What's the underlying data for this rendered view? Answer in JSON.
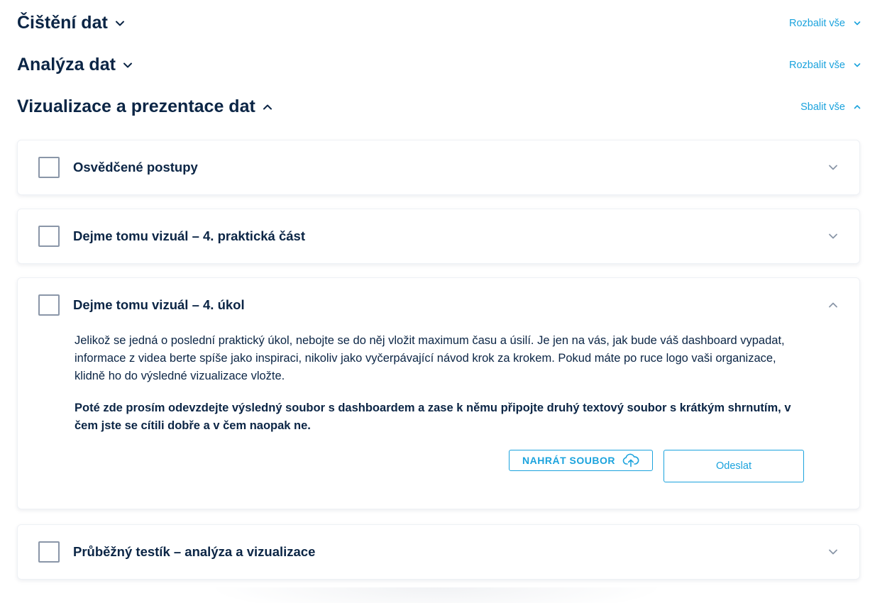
{
  "sections": [
    {
      "title": "Čištění dat",
      "toggle_label": "Rozbalit vše",
      "expanded": false
    },
    {
      "title": "Analýza dat",
      "toggle_label": "Rozbalit vše",
      "expanded": false
    },
    {
      "title": "Vizualizace a prezentace dat",
      "toggle_label": "Sbalit vše",
      "expanded": true
    }
  ],
  "items": [
    {
      "title": "Osvědčené postupy",
      "checked": false,
      "expanded": false
    },
    {
      "title": "Dejme tomu vizuál – 4. praktická část",
      "checked": false,
      "expanded": false
    },
    {
      "title": "Dejme tomu vizuál – 4. úkol",
      "checked": false,
      "expanded": true,
      "body": "Jelikož se jedná o poslední praktický úkol, nebojte se do něj vložit maximum času a úsilí. Je jen na vás, jak bude váš dashboard vypadat, informace z videa berte spíše jako inspiraci, nikoliv jako vyčerpávající návod krok za krokem. Pokud máte po ruce logo vaši organizace, klidně ho do výsledné vizualizace vložte.",
      "instruction": "Poté zde prosím odevzdejte výsledný soubor s dashboardem a zase k němu připojte druhý textový soubor s krátkým shrnutím, v čem jste se cítili dobře a v čem naopak ne.",
      "upload_label": "NAHRÁT SOUBOR",
      "submit_label": "Odeslat"
    },
    {
      "title": "Průběžný testík – analýza a vizualizace",
      "checked": false,
      "expanded": false
    }
  ],
  "colors": {
    "accent": "#1ba3dd",
    "heading": "#0b2545",
    "checkbox_border": "#8a96a8",
    "chevron": "#8a96a8"
  }
}
